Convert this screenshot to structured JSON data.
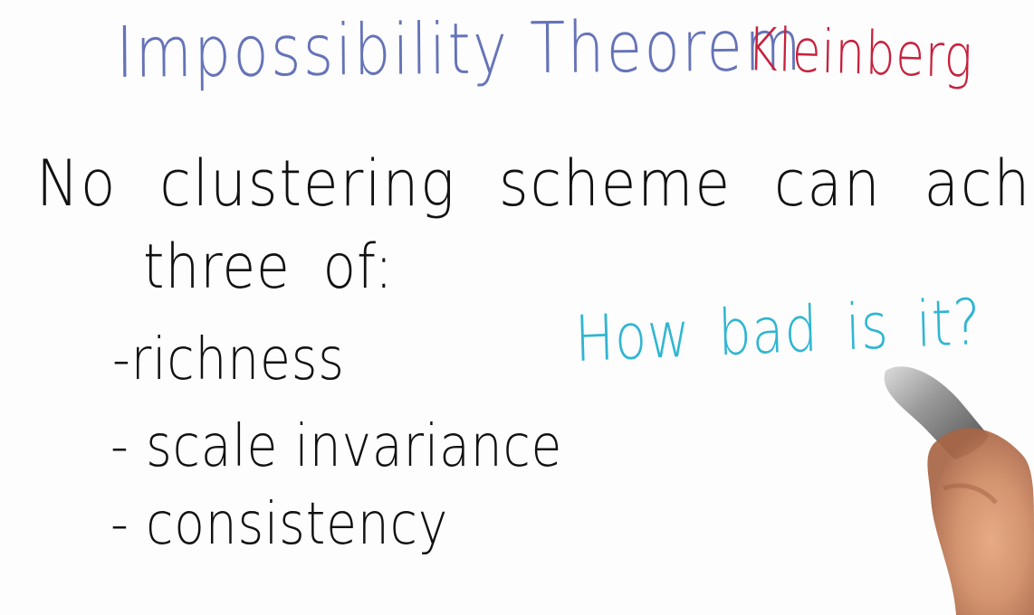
{
  "title": {
    "text": "Impossibility Theorem",
    "author": "Kleinberg"
  },
  "statement": {
    "line1": "No clustering scheme can achieve all",
    "line2": "three of:"
  },
  "criteria": [
    {
      "label": "-richness"
    },
    {
      "label": "- scale invariance"
    },
    {
      "label": "- consistency"
    }
  ],
  "question": "How bad is it?",
  "colors": {
    "title": "#6573b8",
    "author": "#c8203d",
    "statement": "#111111",
    "question": "#2fb6d2"
  },
  "icons": {
    "hand": "hand-holding-marker-icon"
  }
}
